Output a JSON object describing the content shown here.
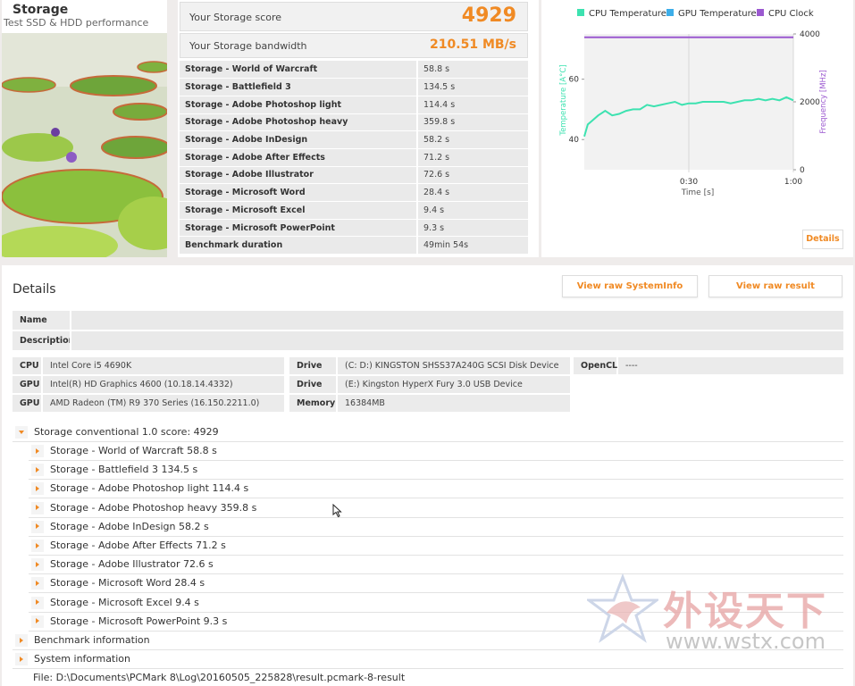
{
  "hero": {
    "title": "Storage",
    "subtitle": "Test SSD & HDD performance"
  },
  "score": {
    "label": "Your Storage score",
    "value": "4929"
  },
  "bandwidth": {
    "label": "Your Storage bandwidth",
    "value": "210.51 MB/s"
  },
  "results": [
    {
      "name": "Storage - World of Warcraft",
      "value": "58.8 s"
    },
    {
      "name": "Storage - Battlefield 3",
      "value": "134.5 s"
    },
    {
      "name": "Storage - Adobe Photoshop light",
      "value": "114.4 s"
    },
    {
      "name": "Storage - Adobe Photoshop heavy",
      "value": "359.8 s"
    },
    {
      "name": "Storage - Adobe InDesign",
      "value": "58.2 s"
    },
    {
      "name": "Storage - Adobe After Effects",
      "value": "71.2 s"
    },
    {
      "name": "Storage - Adobe Illustrator",
      "value": "72.6 s"
    },
    {
      "name": "Storage - Microsoft Word",
      "value": "28.4 s"
    },
    {
      "name": "Storage - Microsoft Excel",
      "value": "9.4 s"
    },
    {
      "name": "Storage - Microsoft PowerPoint",
      "value": "9.3 s"
    },
    {
      "name": "Benchmark duration",
      "value": "49min 54s"
    }
  ],
  "chart_data": {
    "type": "line",
    "title": "",
    "xlabel": "Time [s]",
    "ylabel": "Temperature [A°C]",
    "y2label": "Frequency [MHz]",
    "x_ticks": [
      "0:30",
      "1:00"
    ],
    "y_ticks": [
      "40",
      "60"
    ],
    "y2_ticks": [
      "0",
      "2000",
      "4000"
    ],
    "xlim": [
      0,
      60
    ],
    "ylim": [
      30,
      75
    ],
    "y2lim": [
      0,
      4000
    ],
    "legend_position": "top",
    "series": [
      {
        "name": "CPU Temperature",
        "color": "#3de2b0",
        "axis": "left",
        "x": [
          0,
          1,
          2,
          4,
          6,
          8,
          10,
          12,
          14,
          16,
          18,
          20,
          22,
          24,
          26,
          28,
          30,
          32,
          34,
          36,
          38,
          40,
          42,
          44,
          46,
          48,
          50,
          52,
          54,
          56,
          58,
          60
        ],
        "y": [
          41,
          45,
          46,
          48,
          49.5,
          48,
          48.5,
          49.5,
          50,
          50,
          51.5,
          51,
          51.5,
          52,
          52.5,
          51.5,
          52,
          52,
          52.5,
          52.5,
          52.5,
          52.5,
          52,
          52.5,
          53,
          53,
          53.5,
          53,
          53.5,
          53,
          54,
          53
        ]
      },
      {
        "name": "GPU Temperature",
        "color": "#3daee9",
        "axis": "left",
        "x": [],
        "y": []
      },
      {
        "name": "CPU Clock",
        "color": "#9b59d0",
        "axis": "right",
        "x": [
          0,
          60
        ],
        "y": [
          3900,
          3900
        ]
      }
    ]
  },
  "details_btn": "Details",
  "details": {
    "title": "Details",
    "view_sysinfo": "View raw SystemInfo",
    "view_result": "View raw result",
    "name_label": "Name",
    "name_value": "",
    "desc_label": "Description",
    "desc_value": ""
  },
  "hardware": {
    "cpu_label": "CPU",
    "cpu": "Intel Core i5 4690K",
    "gpu1_label": "GPU",
    "gpu1": "Intel(R) HD Graphics 4600 (10.18.14.4332)",
    "gpu2_label": "GPU",
    "gpu2": "AMD Radeon (TM) R9 370 Series (16.150.2211.0)",
    "drive1_label": "Drive",
    "drive1": "(C: D:) KINGSTON SHSS37A240G SCSI Disk Device",
    "drive2_label": "Drive",
    "drive2": "(E:) Kingston HyperX Fury 3.0 USB Device",
    "memory_label": "Memory",
    "memory": "16384MB",
    "opencl_label": "OpenCL",
    "opencl": "----"
  },
  "tree": {
    "root": "Storage conventional 1.0 score: 4929",
    "items": [
      "Storage - World of Warcraft 58.8 s",
      "Storage - Battlefield 3 134.5 s",
      "Storage - Adobe Photoshop light 114.4 s",
      "Storage - Adobe Photoshop heavy 359.8 s",
      "Storage - Adobe InDesign 58.2 s",
      "Storage - Adobe After Effects 71.2 s",
      "Storage - Adobe Illustrator 72.6 s",
      "Storage - Microsoft Word 28.4 s",
      "Storage - Microsoft Excel 9.4 s",
      "Storage - Microsoft PowerPoint 9.3 s"
    ],
    "benchmark_info": "Benchmark information",
    "system_info": "System information",
    "file": "File: D:\\Documents\\PCMark 8\\Log\\20160505_225828\\result.pcmark-8-result"
  },
  "watermark": {
    "text": "外设天下",
    "url": "www.wstx.com"
  }
}
